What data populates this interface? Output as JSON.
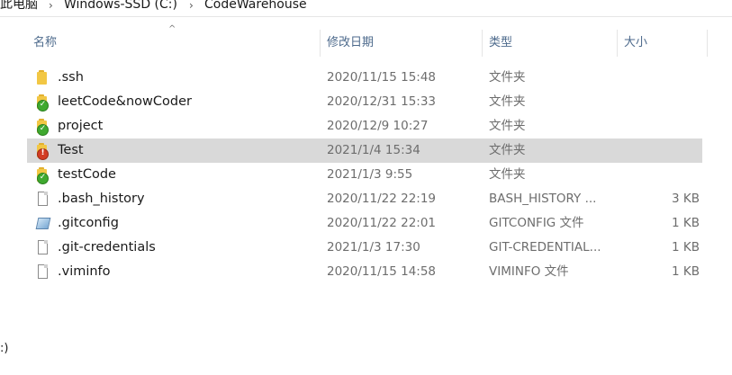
{
  "breadcrumb": {
    "items": [
      "此电脑",
      "Windows-SSD (C:)",
      "CodeWarehouse"
    ],
    "separator": "›"
  },
  "columns": {
    "name": "名称",
    "date": "修改日期",
    "type": "类型",
    "size": "大小",
    "sort_indicator": "^"
  },
  "files": [
    {
      "name": ".ssh",
      "date": "2020/11/15 15:48",
      "type": "文件夹",
      "size": "",
      "icon": "folder-icon"
    },
    {
      "name": "leetCode&nowCoder",
      "date": "2020/12/31 15:33",
      "type": "文件夹",
      "size": "",
      "icon": "folder-synced-icon"
    },
    {
      "name": "project",
      "date": "2020/12/9 10:27",
      "type": "文件夹",
      "size": "",
      "icon": "folder-synced-icon"
    },
    {
      "name": "Test",
      "date": "2021/1/4 15:34",
      "type": "文件夹",
      "size": "",
      "icon": "folder-error-icon"
    },
    {
      "name": "testCode",
      "date": "2021/1/3 9:55",
      "type": "文件夹",
      "size": "",
      "icon": "folder-synced-icon"
    },
    {
      "name": ".bash_history",
      "date": "2020/11/22 22:19",
      "type": "BASH_HISTORY ...",
      "size": "3 KB",
      "icon": "file-icon"
    },
    {
      "name": ".gitconfig",
      "date": "2020/11/22 22:01",
      "type": "GITCONFIG 文件",
      "size": "1 KB",
      "icon": "gitconfig-file-icon"
    },
    {
      "name": ".git-credentials",
      "date": "2021/1/3 17:30",
      "type": "GIT-CREDENTIAL...",
      "size": "1 KB",
      "icon": "file-icon"
    },
    {
      "name": ".viminfo",
      "date": "2020/11/15 14:58",
      "type": "VIMINFO 文件",
      "size": "1 KB",
      "icon": "file-icon"
    }
  ],
  "selected_row": "Test",
  "left_stub": ":)",
  "colors": {
    "header_text": "#4d6a8c",
    "selected_row": "#d9d9d9",
    "folder": "#f2c744",
    "sync_ok": "#3fa92f",
    "sync_error": "#d23c24"
  }
}
